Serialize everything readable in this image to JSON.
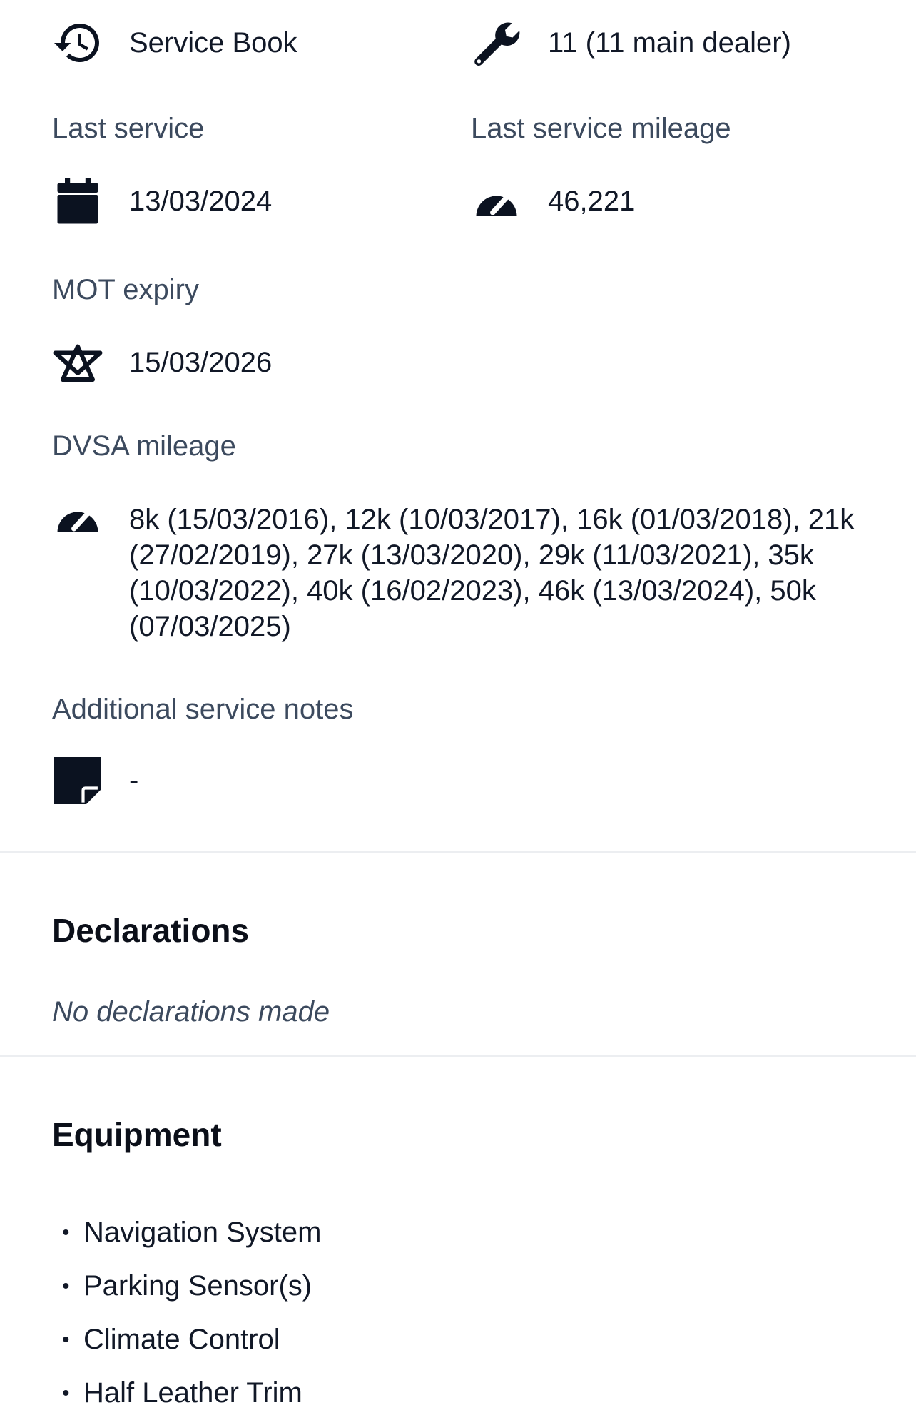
{
  "service_history": {
    "type_value": "Service Book",
    "type_icon": "history-icon",
    "count_value": "11 (11 main dealer)",
    "count_icon": "wrench-icon"
  },
  "last_service": {
    "label": "Last service",
    "value": "13/03/2024",
    "icon": "calendar-icon"
  },
  "last_service_mileage": {
    "label": "Last service mileage",
    "value": "46,221",
    "icon": "speedometer-icon"
  },
  "mot_expiry": {
    "label": "MOT expiry",
    "value": "15/03/2026",
    "icon": "mot-triangles-icon"
  },
  "dvsa_mileage": {
    "label": "DVSA mileage",
    "value": "8k (15/03/2016), 12k (10/03/2017), 16k (01/03/2018), 21k (27/02/2019), 27k (13/03/2020), 29k (11/03/2021), 35k (10/03/2022), 40k (16/02/2023), 46k (13/03/2024), 50k (07/03/2025)",
    "icon": "speedometer-icon"
  },
  "additional_notes": {
    "label": "Additional service notes",
    "value": "-",
    "icon": "sticky-note-icon"
  },
  "declarations": {
    "title": "Declarations",
    "empty_text": "No declarations made"
  },
  "equipment": {
    "title": "Equipment",
    "bullet": "•",
    "items": [
      "Navigation System",
      "Parking Sensor(s)",
      "Climate Control",
      "Half Leather Trim"
    ]
  },
  "colors": {
    "text": "#111827",
    "label": "#3c4a5e",
    "icon": "#0b1220",
    "divider": "#eceef1"
  }
}
